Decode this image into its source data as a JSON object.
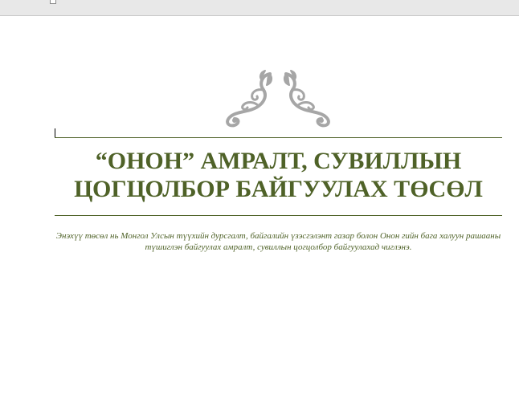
{
  "colors": {
    "accent": "#4f6228",
    "ornament": "#a6a6a6",
    "ruler_background": "#e8e8e8"
  },
  "ornament": {
    "icon": "scroll-flourish-icon"
  },
  "document": {
    "title_line1": "“ОНОН” АМРАЛТ, СУВИЛЛЫН",
    "title_line2": "ЦОГЦОЛБОР БАЙГУУЛАХ ТӨСӨЛ",
    "subtitle": "Энэхүү төсөл нь Монгол Улсын түүхийн дурсгалт, байгалийн үзэсгэлэнт газар болон Онон гийн бага халуун рашааны түшиглэн байгуулах амралт, сувиллын цогцолбор байгуулахад чиглэнэ."
  }
}
